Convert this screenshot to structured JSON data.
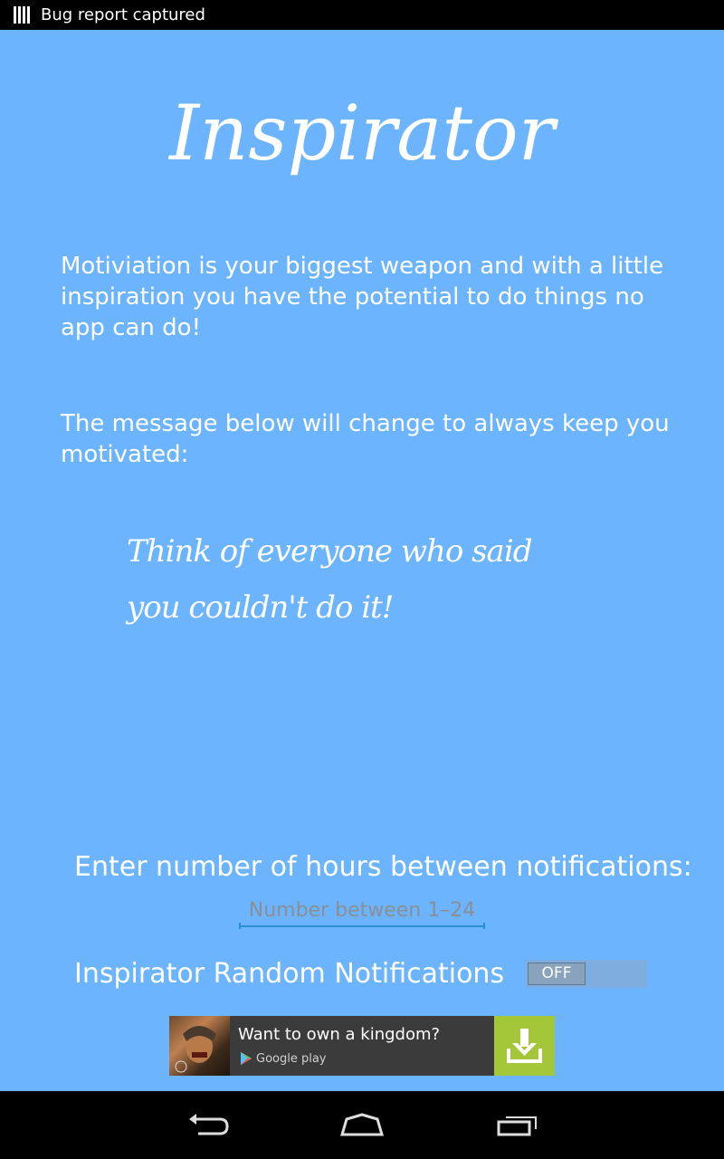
{
  "status_bar": {
    "notification_text": "Bug report captured",
    "icon": "bug-report-icon"
  },
  "app": {
    "title": "Inspirator",
    "intro_text": "Motiviation is your biggest weapon and with a little inspiration you have the potential to do things no app can do!",
    "message_intro": "The message below will change to always keep you motivated:",
    "quote": "Think of everyone who said you couldn't do it!",
    "hours_label": "Enter number of hours between notifications:",
    "hours_input": {
      "value": "",
      "placeholder": "Number between 1–24"
    },
    "notifications_label": "Inspirator Random Notifications",
    "notifications_toggle": {
      "state_label": "OFF",
      "on": false
    }
  },
  "ad": {
    "headline": "Want to own a kingdom?",
    "store_label": "Google play",
    "icons": [
      "game-thumbnail",
      "google-play-icon",
      "download-icon"
    ]
  },
  "nav_bar": {
    "icons": [
      "back-icon",
      "home-icon",
      "recent-apps-icon"
    ]
  },
  "colors": {
    "background": "#6cb4fd",
    "text": "#ffffff",
    "input_underline": "#2a8ecf",
    "ad_background": "#3b3b3b",
    "download_button": "#a4c639",
    "system_bars": "#000000"
  }
}
